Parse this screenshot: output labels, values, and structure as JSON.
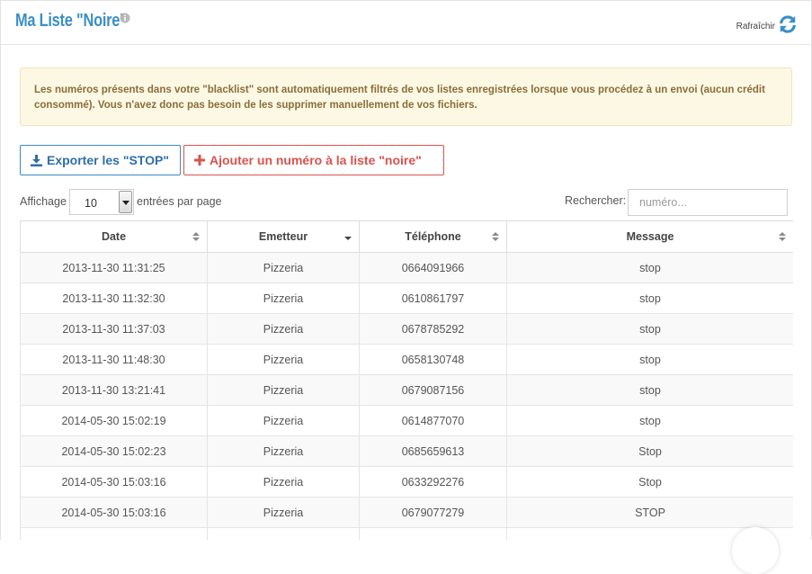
{
  "header": {
    "title": "Ma Liste \"Noire\"",
    "info_icon": "info-circle-icon",
    "refresh_label": "Rafraîchir",
    "refresh_icon": "refresh-icon"
  },
  "alert": {
    "text": "Les numéros présents dans votre \"blacklist\" sont automatiquement filtrés de vos listes enregistrées lorsque vous procédez à un envoi (aucun crédit consommé). Vous n'avez donc pas besoin de les supprimer manuellement de vos fichiers."
  },
  "actions": {
    "export_label": "Exporter les \"STOP\"",
    "export_icon": "download-icon",
    "add_label": "Ajouter un numéro à la liste \"noire\"",
    "add_icon": "plus-icon"
  },
  "length_control": {
    "prefix": "Affichage",
    "value": "10",
    "suffix": "entrées par page"
  },
  "search": {
    "label": "Rechercher:",
    "placeholder": "numéro..."
  },
  "table": {
    "columns": [
      "Date",
      "Emetteur",
      "Téléphone",
      "Message"
    ],
    "rows": [
      [
        "2013-11-30 11:31:25",
        "Pizzeria",
        "0664091966",
        "stop"
      ],
      [
        "2013-11-30 11:32:30",
        "Pizzeria",
        "0610861797",
        "stop"
      ],
      [
        "2013-11-30 11:37:03",
        "Pizzeria",
        "0678785292",
        "stop"
      ],
      [
        "2013-11-30 11:48:30",
        "Pizzeria",
        "0658130748",
        "stop"
      ],
      [
        "2013-11-30 13:21:41",
        "Pizzeria",
        "0679087156",
        "stop"
      ],
      [
        "2014-05-30 15:02:19",
        "Pizzeria",
        "0614877070",
        "stop"
      ],
      [
        "2014-05-30 15:02:23",
        "Pizzeria",
        "0685659613",
        "Stop"
      ],
      [
        "2014-05-30 15:03:16",
        "Pizzeria",
        "0633292276",
        "Stop"
      ],
      [
        "2014-05-30 15:03:16",
        "Pizzeria",
        "0679077279",
        "STOP"
      ],
      [
        "",
        "",
        "",
        ""
      ]
    ]
  },
  "colors": {
    "accent": "#3a8fc7",
    "danger": "#d9534f",
    "warning_bg": "#fcf8e3",
    "warning_text": "#8a6d3b"
  }
}
